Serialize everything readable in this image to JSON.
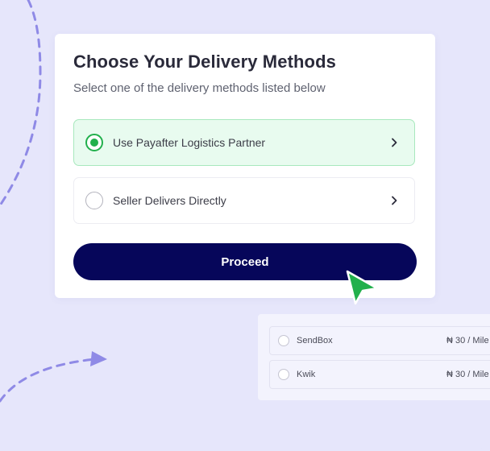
{
  "card": {
    "title": "Choose Your Delivery Methods",
    "subtitle": "Select one of the delivery methods listed below"
  },
  "options": [
    {
      "label": "Use Payafter Logistics Partner",
      "selected": true
    },
    {
      "label": "Seller Delivers Directly",
      "selected": false
    }
  ],
  "proceed_label": "Proceed",
  "carriers": [
    {
      "name": "SendBox",
      "price": "₦ 30 / Mile"
    },
    {
      "name": "Kwik",
      "price": "₦ 30 / Mile"
    }
  ],
  "colors": {
    "background": "#e6e6fb",
    "accent_green": "#22b04c",
    "primary_navy": "#06065a",
    "selected_bg": "#e8fbef",
    "dashed_decoration": "#8f8ae6"
  },
  "icons": [
    "radio-selected-icon",
    "radio-icon",
    "chevron-right-icon",
    "cursor-arrow-icon",
    "arrow-head-icon"
  ]
}
